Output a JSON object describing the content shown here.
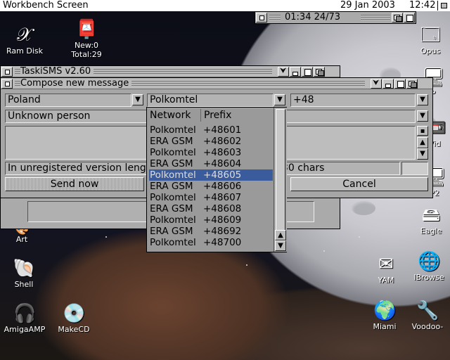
{
  "screen": {
    "title": "Workbench Screen",
    "date": "29 Jan 2003",
    "time": "12:42"
  },
  "clock_window": {
    "text": "01:34 24/73"
  },
  "desktop_icons": [
    {
      "label": "Ram Disk",
      "icon": "ram-disk-icon"
    },
    {
      "label": "New:0 Total:29",
      "icon": "mailbox-icon"
    },
    {
      "label": "Opus",
      "icon": "opus-icon"
    },
    {
      "label": "P",
      "icon": "drawer-icon"
    },
    {
      "label": "Vid",
      "icon": "video-icon"
    },
    {
      "label": "P2",
      "icon": "drawer-icon"
    },
    {
      "label": "Eagle",
      "icon": "eagle-icon"
    },
    {
      "label": "Art",
      "icon": "art-icon"
    },
    {
      "label": "Shell",
      "icon": "shell-icon"
    },
    {
      "label": "AmigaAMP",
      "icon": "amigaamp-icon"
    },
    {
      "label": "MakeCD",
      "icon": "makecd-icon"
    },
    {
      "label": "YAM",
      "icon": "yam-icon"
    },
    {
      "label": "IBrowse",
      "icon": "ibrowse-icon"
    },
    {
      "label": "Miami",
      "icon": "miami-icon"
    },
    {
      "label": "Voodoo-",
      "icon": "voodoo-icon"
    }
  ],
  "taskisms": {
    "title": "TaskiSMS v2.60"
  },
  "compose": {
    "title": "Compose new message",
    "country": "Poland",
    "network": "Polkomtel",
    "prefix": "+48",
    "recipient": "Unknown person",
    "message": "",
    "status_left": "In unregistered version length",
    "status_right": "30 chars",
    "send_label": "Send now",
    "cancel_label": "Cancel"
  },
  "network_list": {
    "headers": {
      "network": "Network",
      "prefix": "Prefix"
    },
    "rows": [
      {
        "network": "Polkomtel",
        "prefix": "+48601"
      },
      {
        "network": "ERA GSM",
        "prefix": "+48602"
      },
      {
        "network": "Polkomtel",
        "prefix": "+48603"
      },
      {
        "network": "ERA GSM",
        "prefix": "+48604"
      },
      {
        "network": "Polkomtel",
        "prefix": "+48605",
        "selected": true
      },
      {
        "network": "ERA GSM",
        "prefix": "+48606"
      },
      {
        "network": "Polkomtel",
        "prefix": "+48607"
      },
      {
        "network": "ERA GSM",
        "prefix": "+48608"
      },
      {
        "network": "Polkomtel",
        "prefix": "+48609"
      },
      {
        "network": "ERA GSM",
        "prefix": "+48692"
      },
      {
        "network": "Polkomtel",
        "prefix": "+48700"
      }
    ]
  },
  "colors": {
    "selection": "#3a5b9c",
    "window": "#aaaaaa"
  }
}
